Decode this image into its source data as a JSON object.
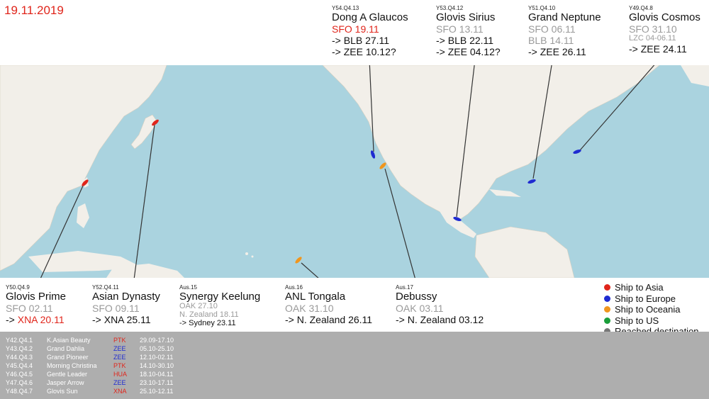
{
  "date": "19.11.2019",
  "colors": {
    "asia": "#e0251b",
    "europe": "#1f2bd1",
    "oceania": "#f0961e",
    "us": "#1a9e3a",
    "done": "#777777",
    "land": "#f2efe9",
    "sea": "#aad3df"
  },
  "top_cards": [
    {
      "code": "Y54.Q4.13",
      "name": "Dong A Glaucos",
      "lines": [
        {
          "text": "SFO 19.11",
          "color": "red"
        },
        {
          "text": "-> BLB 27.11",
          "color": "blk"
        },
        {
          "text": "-> ZEE 10.12?",
          "color": "blk"
        }
      ]
    },
    {
      "code": "Y53.Q4.12",
      "name": "Glovis Sirius",
      "lines": [
        {
          "text": "SFO 13.11",
          "color": "gray"
        },
        {
          "text": "-> BLB 22.11",
          "color": "blk"
        },
        {
          "text": "-> ZEE 04.12?",
          "color": "blk"
        }
      ]
    },
    {
      "code": "Y51.Q4.10",
      "name": "Grand Neptune",
      "lines": [
        {
          "text": "SFO 06.11",
          "color": "gray"
        },
        {
          "text": "BLB 14.11",
          "color": "gray"
        },
        {
          "text": "-> ZEE 26.11",
          "color": "blk"
        }
      ]
    },
    {
      "code": "Y49.Q4.8",
      "name": "Glovis Cosmos",
      "lines": [
        {
          "text": "SFO 31.10",
          "color": "gray"
        },
        {
          "text": "LZC 04-06.11",
          "color": "gray",
          "small": true
        },
        {
          "text": "-> ZEE  24.11",
          "color": "blk"
        }
      ]
    }
  ],
  "bottom_cards": [
    {
      "code": "Y50.Q4.9",
      "name": "Glovis Prime",
      "lines": [
        {
          "text": "SFO 02.11",
          "color": "gray"
        },
        {
          "text": "-> ",
          "color": "blk",
          "tail": "XNA 20.11",
          "tail_color": "red"
        }
      ]
    },
    {
      "code": "Y52.Q4.11",
      "name": "Asian Dynasty",
      "lines": [
        {
          "text": "SFO 09.11",
          "color": "gray"
        },
        {
          "text": "-> XNA 25.11",
          "color": "blk"
        }
      ]
    },
    {
      "code": "Aus.15",
      "name": "Synergy Keelung",
      "lines": [
        {
          "text": "OAK 27.10",
          "color": "gray",
          "small": true
        },
        {
          "text": "N. Zealand 18.11",
          "color": "gray",
          "small": true
        },
        {
          "text": "-> Sydney 23.11",
          "color": "blk",
          "small": true
        }
      ]
    },
    {
      "code": "Aus.16",
      "name": "ANL Tongala",
      "lines": [
        {
          "text": "OAK 31.10",
          "color": "gray"
        },
        {
          "text": "-> N. Zealand 26.11",
          "color": "blk"
        }
      ]
    },
    {
      "code": "Aus.17",
      "name": "Debussy",
      "lines": [
        {
          "text": "OAK 03.11",
          "color": "gray"
        },
        {
          "text": "-> N. Zealand 03.12",
          "color": "blk"
        }
      ]
    }
  ],
  "legend": [
    {
      "label": "Ship to Asia",
      "color": "#e0251b"
    },
    {
      "label": "Ship to Europe",
      "color": "#1f2bd1"
    },
    {
      "label": "Ship to Oceania",
      "color": "#f0961e"
    },
    {
      "label": "Ship to US",
      "color": "#1a9e3a"
    },
    {
      "label": "Reached destination",
      "color": "#777777"
    }
  ],
  "completed": [
    {
      "code": "Y42.Q4.1",
      "ship": "K.Asian Beauty",
      "port": "PTK",
      "port_color": "#e0251b",
      "dates": "29.09-17.10"
    },
    {
      "code": "Y43.Q4.2",
      "ship": "Grand Dahlia",
      "port": "ZEE",
      "port_color": "#1f2bd1",
      "dates": "05.10-25.10"
    },
    {
      "code": "Y44.Q4.3",
      "ship": "Grand Pioneer",
      "port": "ZEE",
      "port_color": "#1f2bd1",
      "dates": "12.10-02.11"
    },
    {
      "code": "Y45.Q4.4",
      "ship": "Morning Christina",
      "port": "PTK",
      "port_color": "#e0251b",
      "dates": "14.10-30.10"
    },
    {
      "code": "Y46.Q4.5",
      "ship": "Gentle Leader",
      "port": "HUA",
      "port_color": "#e0251b",
      "dates": "18.10-04.11"
    },
    {
      "code": "Y47.Q4.6",
      "ship": "Jasper Arrow",
      "port": "ZEE",
      "port_color": "#1f2bd1",
      "dates": "23.10-17.11"
    },
    {
      "code": "Y48.Q4.7",
      "ship": "Glovis Sun",
      "port": "XNA",
      "port_color": "#e0251b",
      "dates": "25.10-12.11"
    }
  ]
}
